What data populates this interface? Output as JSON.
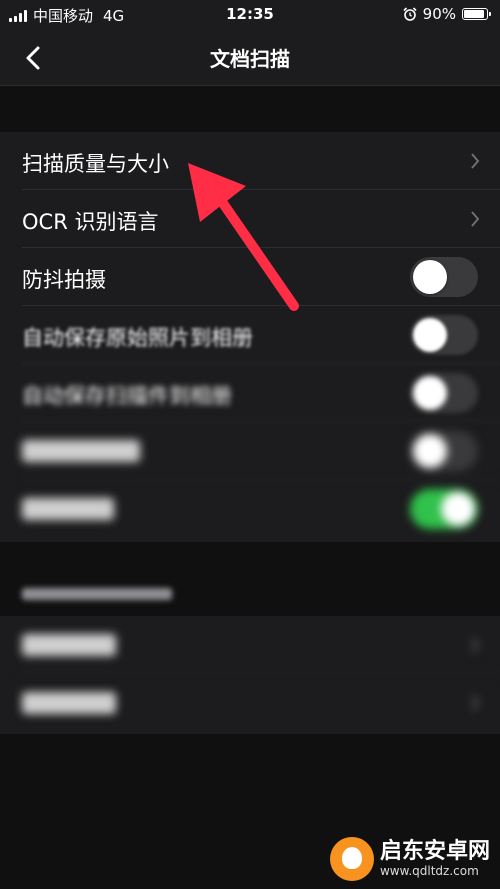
{
  "status_bar": {
    "carrier": "中国移动",
    "network": "4G",
    "time": "12:35",
    "battery_percent": "90%",
    "battery_level": 0.9,
    "alarm_icon": "alarm-clock-icon"
  },
  "nav": {
    "title": "文档扫描",
    "back_icon": "chevron-left-icon"
  },
  "settings": {
    "rows": [
      {
        "label": "扫描质量与大小",
        "type": "link"
      },
      {
        "label": "OCR 识别语言",
        "type": "link"
      },
      {
        "label": "防抖拍摄",
        "type": "toggle",
        "on": false
      },
      {
        "label": "自动保存原始照片到相册",
        "type": "toggle",
        "on": false
      },
      {
        "label": "自动保存扫描件到相册",
        "type": "toggle",
        "on": false
      }
    ]
  },
  "colors": {
    "background": "#1c1c1e",
    "toggle_on": "#30c24b",
    "arrow": "#ff2d45"
  },
  "watermark": {
    "name": "启东安卓网",
    "url": "www.qdltdz.com"
  }
}
